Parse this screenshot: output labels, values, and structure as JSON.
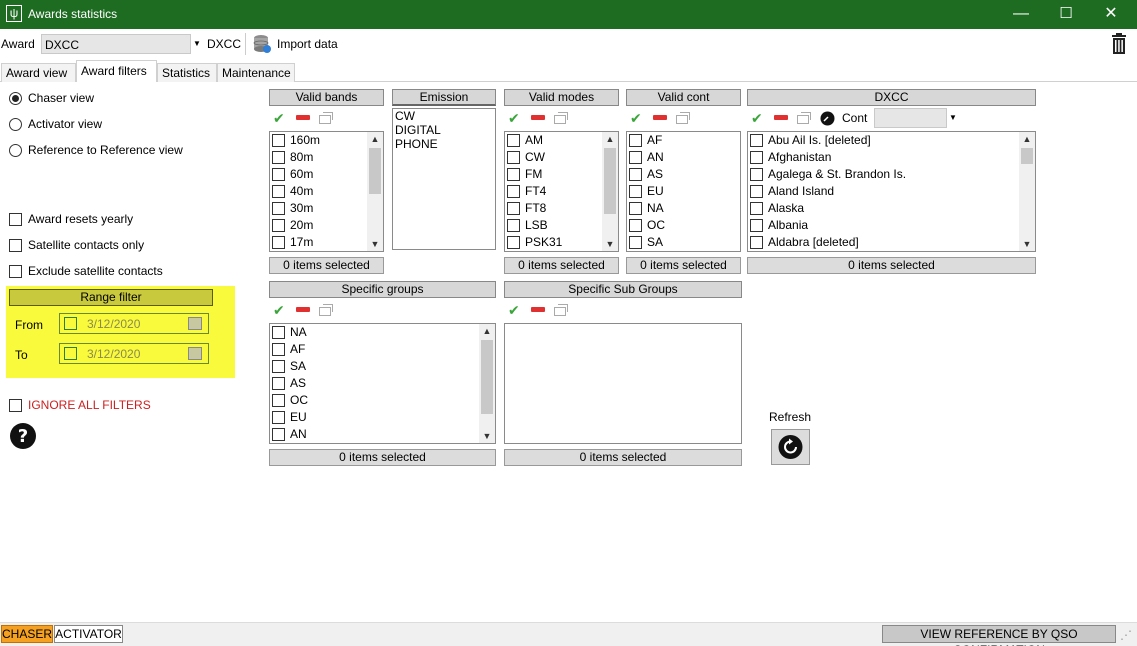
{
  "window": {
    "title": "Awards statistics",
    "minimize": "—",
    "maximize": "☐",
    "close": "✕"
  },
  "toolbar": {
    "award_label": "Award",
    "award_value": "DXCC",
    "award_name": "DXCC",
    "import_label": "Import data"
  },
  "tabs": [
    "Award view",
    "Award filters",
    "Statistics",
    "Maintenance"
  ],
  "view_options": [
    "Chaser view",
    "Activator view",
    "Reference to Reference view"
  ],
  "options": [
    "Award resets yearly",
    "Satellite contacts only",
    "Exclude satellite contacts"
  ],
  "range_filter": {
    "header": "Range filter",
    "from_label": "From",
    "from_value": "3/12/2020",
    "to_label": "To",
    "to_value": "3/12/2020"
  },
  "ignore_filters": "IGNORE ALL FILTERS",
  "panels": {
    "valid_bands": {
      "title": "Valid bands",
      "items": [
        "160m",
        "80m",
        "60m",
        "40m",
        "30m",
        "20m",
        "17m"
      ],
      "footer": "0 items selected"
    },
    "emission": {
      "title": "Emission",
      "items": [
        "CW",
        "DIGITAL",
        "PHONE"
      ]
    },
    "valid_modes": {
      "title": "Valid modes",
      "items": [
        "AM",
        "CW",
        "FM",
        "FT4",
        "FT8",
        "LSB",
        "PSK31"
      ],
      "footer": "0 items selected"
    },
    "valid_cont": {
      "title": "Valid cont",
      "items": [
        "AF",
        "AN",
        "AS",
        "EU",
        "NA",
        "OC",
        "SA"
      ],
      "footer": "0 items selected"
    },
    "dxcc": {
      "title": "DXCC",
      "cont_label": "Cont",
      "items": [
        "Abu Ail Is. [deleted]",
        "Afghanistan",
        "Agalega & St. Brandon Is.",
        "Aland Island",
        "Alaska",
        "Albania",
        "Aldabra [deleted]"
      ],
      "footer": "0 items selected"
    },
    "specific_groups": {
      "title": "Specific groups",
      "items": [
        "NA",
        "AF",
        "SA",
        "AS",
        "OC",
        "EU",
        "AN"
      ],
      "footer": "0 items selected"
    },
    "specific_sub_groups": {
      "title": "Specific Sub Groups",
      "footer": "0 items selected"
    }
  },
  "refresh_label": "Refresh",
  "status": {
    "chaser": "CHASER",
    "activator": "ACTIVATOR",
    "view_reference": "VIEW REFERENCE BY QSO CONFIRMATION"
  },
  "colors": {
    "titlebar": "#1e6b22",
    "range_highlight": "#fafa3c",
    "chaser_badge": "#f5a020",
    "ignore_text": "#cc1f1f"
  }
}
